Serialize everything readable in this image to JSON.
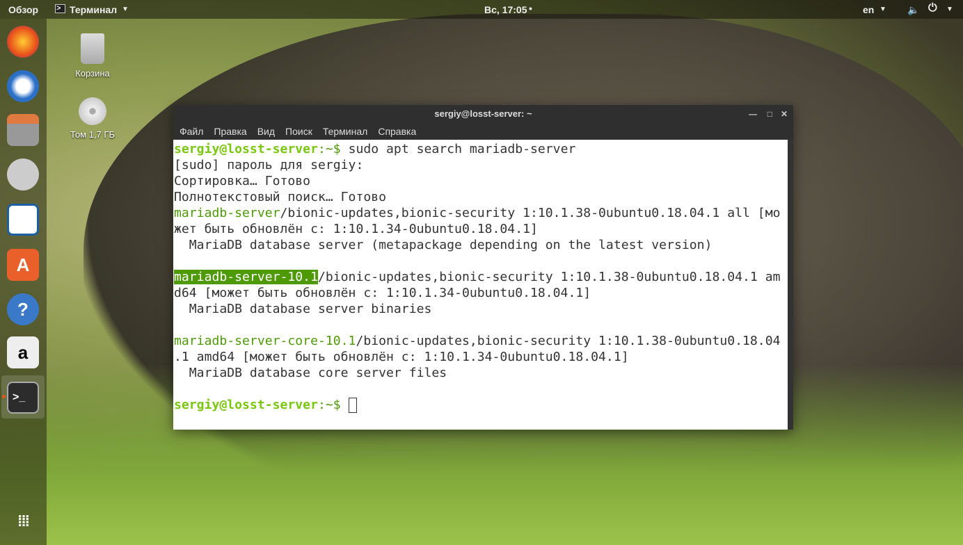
{
  "topbar": {
    "overview": "Обзор",
    "app": "Терминал",
    "clock": "Вс, 17:05",
    "lang": "en"
  },
  "desktop": {
    "trash": "Корзина",
    "volume": "Том 1,7 ГБ"
  },
  "terminal": {
    "title": "sergiy@losst-server: ~",
    "menu": [
      "Файл",
      "Правка",
      "Вид",
      "Поиск",
      "Терминал",
      "Справка"
    ],
    "prompt_user": "sergiy@losst-server",
    "prompt_path": ":~$ ",
    "command": "sudo apt search mariadb-server",
    "lines": [
      "[sudo] пароль для sergiy:",
      "Сортировка… Готово",
      "Полнотекстовый поиск… Готово"
    ],
    "packages": [
      {
        "name": "mariadb-server",
        "rest1": "/bionic-updates,bionic-security 1:10.1.38-0ubuntu0.18.04.1 all [мо",
        "rest2": "жет быть обновлён с: 1:10.1.34-0ubuntu0.18.04.1]",
        "desc": "  MariaDB database server (metapackage depending on the latest version)"
      },
      {
        "name": "mariadb-server-10.1",
        "rest1": "/bionic-updates,bionic-security 1:10.1.38-0ubuntu0.18.04.1 am",
        "rest2": "d64 [может быть обновлён с: 1:10.1.34-0ubuntu0.18.04.1]",
        "desc": "  MariaDB database server binaries"
      },
      {
        "name": "mariadb-server-core-10.1",
        "rest1": "/bionic-updates,bionic-security 1:10.1.38-0ubuntu0.18.04",
        "rest2": ".1 amd64 [может быть обновлён с: 1:10.1.34-0ubuntu0.18.04.1]",
        "desc": "  MariaDB database core server files"
      }
    ]
  }
}
